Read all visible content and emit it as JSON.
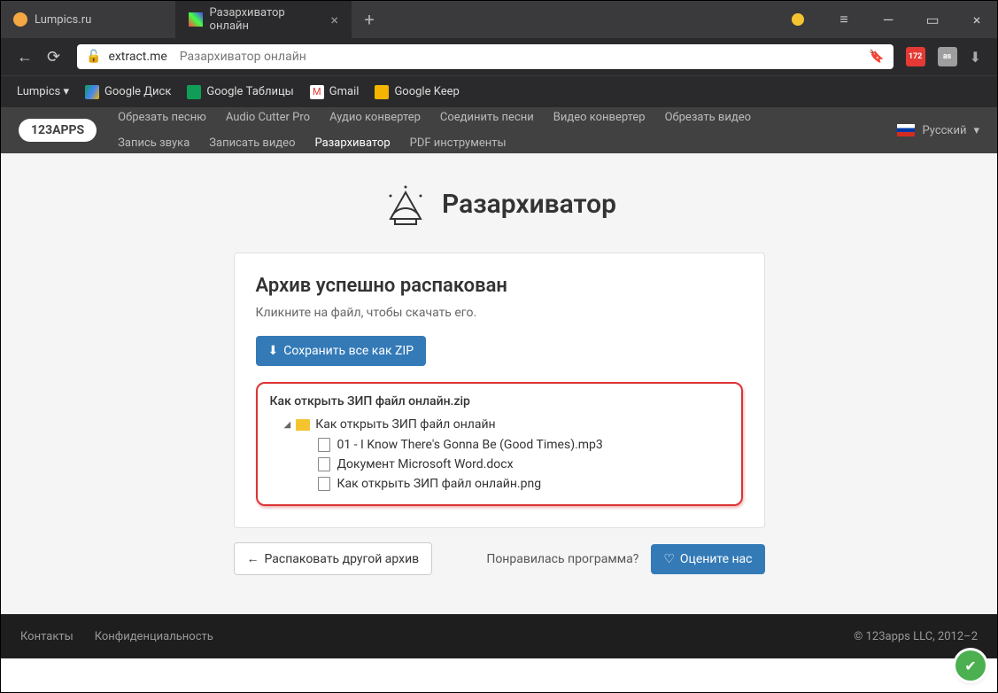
{
  "tabs": [
    {
      "label": "Lumpics.ru"
    },
    {
      "label": "Разархиватор онлайн"
    }
  ],
  "addr": {
    "domain": "extract.me",
    "title": "Разархиватор онлайн"
  },
  "badge172": "172",
  "bookmarks": [
    {
      "label": "Lumpics ▾"
    },
    {
      "label": "Google Диск"
    },
    {
      "label": "Google Таблицы"
    },
    {
      "label": "Gmail"
    },
    {
      "label": "Google Keep"
    }
  ],
  "topnav": {
    "logo": "123APPS",
    "links": [
      "Обрезать песню",
      "Audio Cutter Pro",
      "Аудио конвертер",
      "Соединить песни",
      "Видео конвертер",
      "Обрезать видео",
      "Запись звука",
      "Записать видео",
      "Разархиватор",
      "PDF инструменты"
    ],
    "active_index": 8,
    "lang": "Русский"
  },
  "hero": {
    "title": "Разархиватор"
  },
  "card": {
    "heading": "Архив успешно распакован",
    "sub": "Кликните на файл, чтобы скачать его.",
    "save_btn": "Сохранить все как ZIP"
  },
  "tree": {
    "root": "Как открыть ЗИП файл онлайн.zip",
    "folder": "Как открыть ЗИП файл онлайн",
    "files": [
      "01 - I Know There's Gonna Be (Good Times).mp3",
      "Документ Microsoft Word.docx",
      "Как открыть ЗИП файл онлайн.png"
    ]
  },
  "actions": {
    "another": "Распаковать другой архив",
    "like": "Понравилась программа?",
    "rate": "Оцените нас"
  },
  "footer": {
    "contacts": "Контакты",
    "privacy": "Конфиденциальность",
    "copyright": "© 123apps LLC, 2012–2"
  }
}
